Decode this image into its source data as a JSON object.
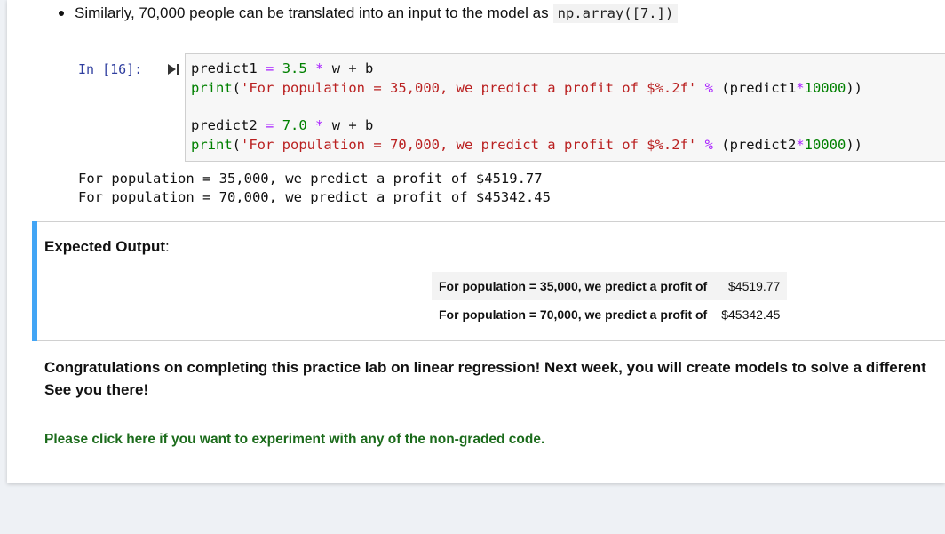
{
  "bullet": {
    "text": "Similarly, 70,000 people can be translated into an input to the model as",
    "code": "np.array([7.])"
  },
  "cell": {
    "prompt": "In [16]:",
    "lines": [
      {
        "var": "predict1",
        "eq": "=",
        "num": "3.5",
        "op": "*",
        "rest": "w + b"
      },
      {
        "fn": "print",
        "str": "'For population = 35,000, we predict a profit of $%.2f'",
        "op": "%",
        "expr_a": "(predict1",
        "op2": "*",
        "num": "10000",
        "expr_b": "))"
      },
      {
        "var": "predict2",
        "eq": "=",
        "num": "7.0",
        "op": "*",
        "rest": "w + b"
      },
      {
        "fn": "print",
        "str": "'For population = 70,000, we predict a profit of $%.2f'",
        "op": "%",
        "expr_a": "(predict2",
        "op2": "*",
        "num": "10000",
        "expr_b": "))"
      }
    ]
  },
  "output": [
    "For population = 35,000, we predict a profit of $4519.77",
    "For population = 70,000, we predict a profit of $45342.45"
  ],
  "expected": {
    "title": "Expected Output",
    "colon": ":",
    "rows": [
      {
        "label": "For population = 35,000, we predict a profit of",
        "value": "$4519.77"
      },
      {
        "label": "For population = 70,000, we predict a profit of",
        "value": "$45342.45"
      }
    ]
  },
  "congrats": {
    "line1": "Congratulations on completing this practice lab on linear regression! Next week, you will create models to solve a different",
    "line2": "See you there!"
  },
  "link": {
    "text": "Please click here if you want to experiment with any of the non-graded code."
  },
  "colors": {
    "accent_bar": "#42a5f5",
    "link_green": "#1b6b1b",
    "prompt_blue": "#303f9f"
  }
}
